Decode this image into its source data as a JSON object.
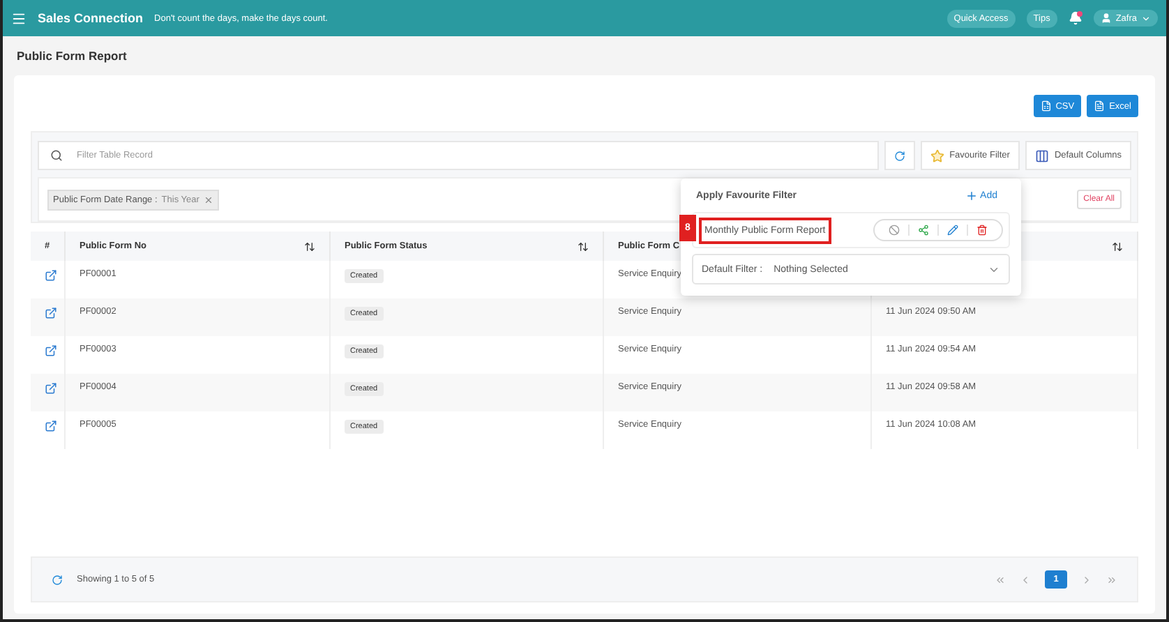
{
  "header": {
    "app_name": "Sales Connection",
    "tagline": "Don't count the days, make the days count.",
    "quick_access": "Quick Access",
    "tips": "Tips",
    "notification_unread": true,
    "user": "Zafra"
  },
  "page_title": "Public Form Report",
  "export_buttons": [
    {
      "kind": "csv",
      "label": "CSV"
    },
    {
      "kind": "excel",
      "label": "Excel"
    }
  ],
  "search": {
    "placeholder": "Filter Table Record"
  },
  "toolbar": {
    "favourite_filter": "Favourite Filter",
    "default_columns": "Default Columns"
  },
  "chips": [
    {
      "label": "Public Form Date Range :",
      "value": "This Year"
    }
  ],
  "clear_all": "Clear All",
  "table": {
    "columns": [
      {
        "label": "#"
      },
      {
        "label": "Public Form No",
        "sortable": true
      },
      {
        "label": "Public Form Status",
        "sortable": true
      },
      {
        "label": "Public Form C"
      },
      {
        "sortable": true
      }
    ],
    "rows": [
      {
        "no": "PF00001",
        "status": "Created",
        "type": "Service Enquiry"
      },
      {
        "no": "PF00002",
        "status": "Created",
        "type": "Service Enquiry",
        "date": "11 Jun 2024 09:50 AM"
      },
      {
        "no": "PF00003",
        "status": "Created",
        "type": "Service Enquiry",
        "date": "11 Jun 2024 09:54 AM"
      },
      {
        "no": "PF00004",
        "status": "Created",
        "type": "Service Enquiry",
        "date": "11 Jun 2024 09:58 AM"
      },
      {
        "no": "PF00005",
        "status": "Created",
        "type": "Service Enquiry",
        "date": "11 Jun 2024 10:08 AM"
      }
    ]
  },
  "favourite_popover": {
    "title": "Apply Favourite Filter",
    "add": "Add",
    "items": [
      {
        "name": "Monthly Public Form Report",
        "annotation": "8"
      }
    ],
    "default_filter": {
      "label": "Default Filter :",
      "value": "Nothing Selected"
    }
  },
  "pagination": {
    "summary": "Showing 1 to 5 of 5",
    "pages": [
      {
        "label": "1",
        "selected": true
      }
    ]
  }
}
